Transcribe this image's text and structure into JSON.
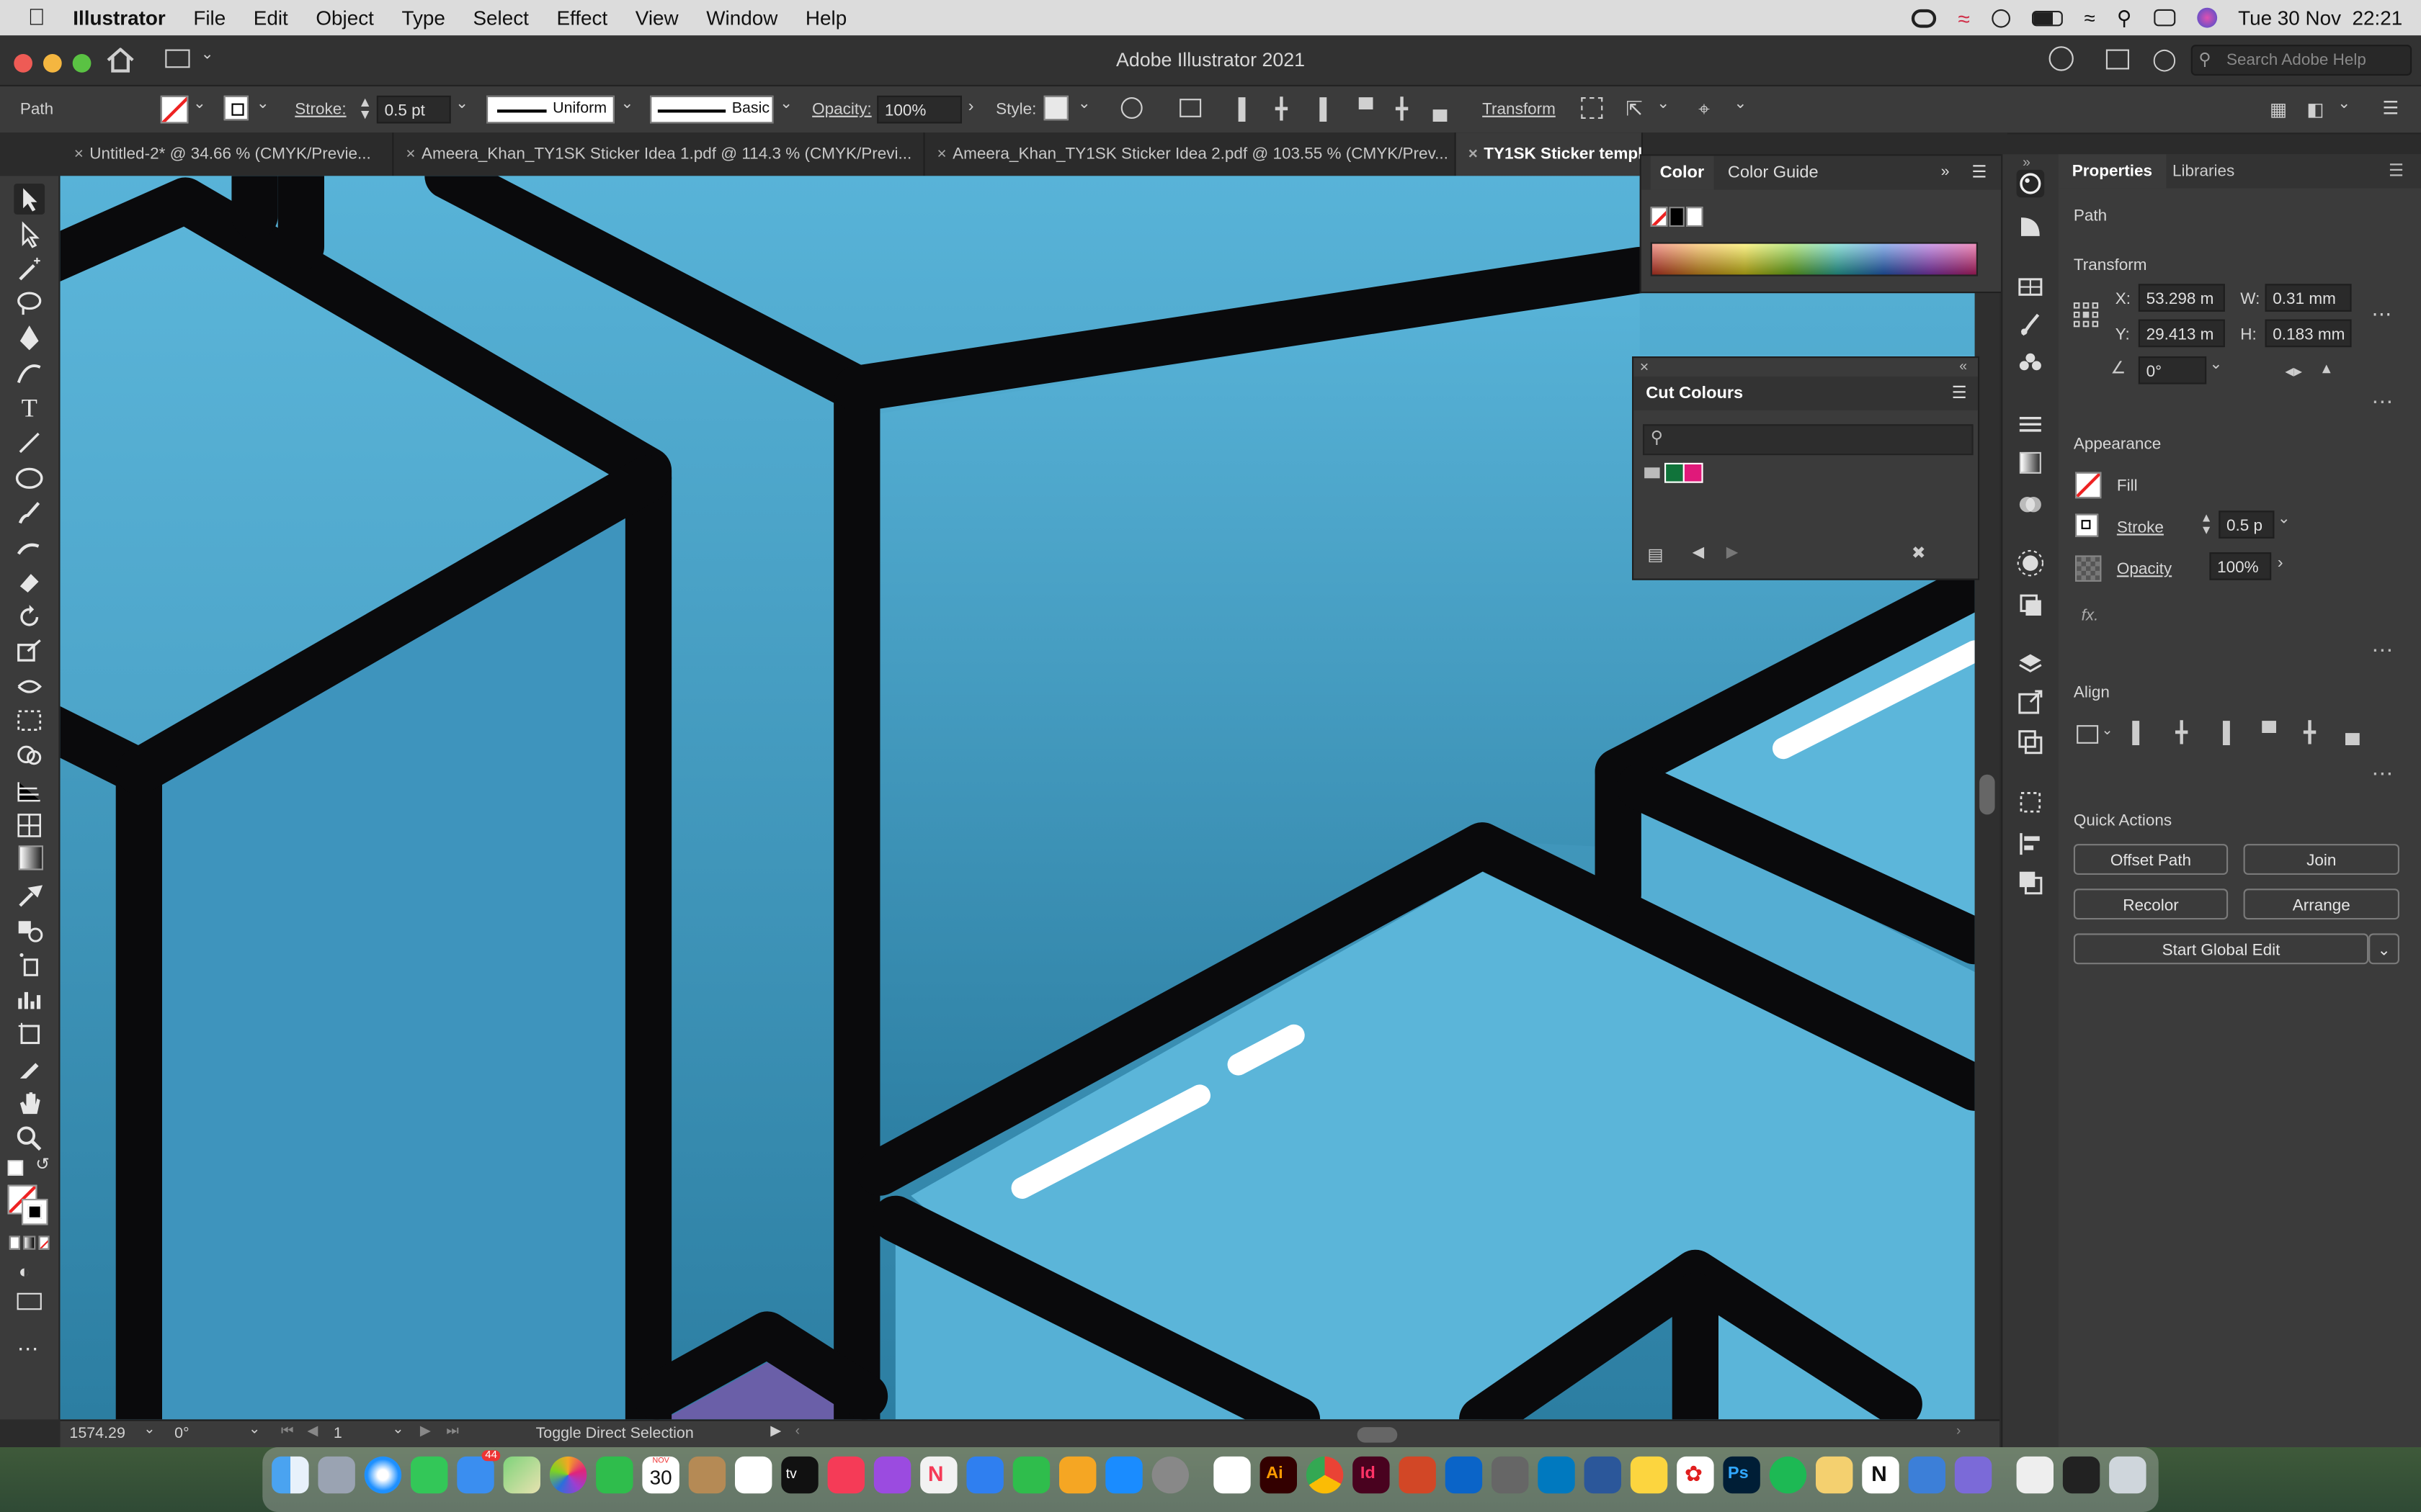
{
  "menubar": {
    "app": "Illustrator",
    "items": [
      "File",
      "Edit",
      "Object",
      "Type",
      "Select",
      "Effect",
      "View",
      "Window",
      "Help"
    ],
    "clock": "Tue 30 Nov  22:21"
  },
  "appbar": {
    "title": "Adobe Illustrator 2021",
    "search_placeholder": "Search Adobe Help"
  },
  "control": {
    "selection_type": "Path",
    "stroke_label": "Stroke:",
    "stroke_value": "0.5 pt",
    "profile": "Uniform",
    "brush": "Basic",
    "opacity_label": "Opacity:",
    "opacity_value": "100%",
    "style_label": "Style:",
    "transform_label": "Transform"
  },
  "tabs": [
    {
      "label": "Untitled-2* @ 34.66 % (CMYK/Previe..."
    },
    {
      "label": "Ameera_Khan_TY1SK Sticker Idea 1.pdf @ 114.3 % (CMYK/Previ..."
    },
    {
      "label": "Ameera_Khan_TY1SK Sticker Idea 2.pdf @ 103.55 % (CMYK/Prev..."
    },
    {
      "label": "TY1SK Sticker templ"
    }
  ],
  "color_panel": {
    "tab1": "Color",
    "tab2": "Color Guide"
  },
  "cut_colours": {
    "title": "Cut Colours"
  },
  "properties": {
    "tab1": "Properties",
    "tab2": "Libraries",
    "object": "Path",
    "transform_title": "Transform",
    "x_label": "X:",
    "x_value": "53.298 m",
    "y_label": "Y:",
    "y_value": "29.413 m",
    "w_label": "W:",
    "w_value": "0.31 mm",
    "h_label": "H:",
    "h_value": "0.183 mm",
    "angle_value": "0°",
    "appearance_title": "Appearance",
    "fill_label": "Fill",
    "stroke_label": "Stroke",
    "stroke_value": "0.5 p",
    "opacity_label": "Opacity",
    "opacity_value": "100%",
    "fx_label": "fx.",
    "align_title": "Align",
    "quick_actions_title": "Quick Actions",
    "btn_offset": "Offset Path",
    "btn_join": "Join",
    "btn_recolor": "Recolor",
    "btn_arrange": "Arrange",
    "btn_global": "Start Global Edit"
  },
  "status": {
    "zoom": "1574.29",
    "rotate": "0°",
    "artboard": "1",
    "tool_hint": "Toggle Direct Selection"
  },
  "dock": {
    "mail_badge": "44",
    "calendar_day": "30",
    "calendar_month": "NOV"
  },
  "colors": {
    "canvas_light": "#55b1d6",
    "canvas_dark": "#2d7fa3",
    "outline": "#0a0a0c",
    "purple": "#6a5fa8"
  }
}
